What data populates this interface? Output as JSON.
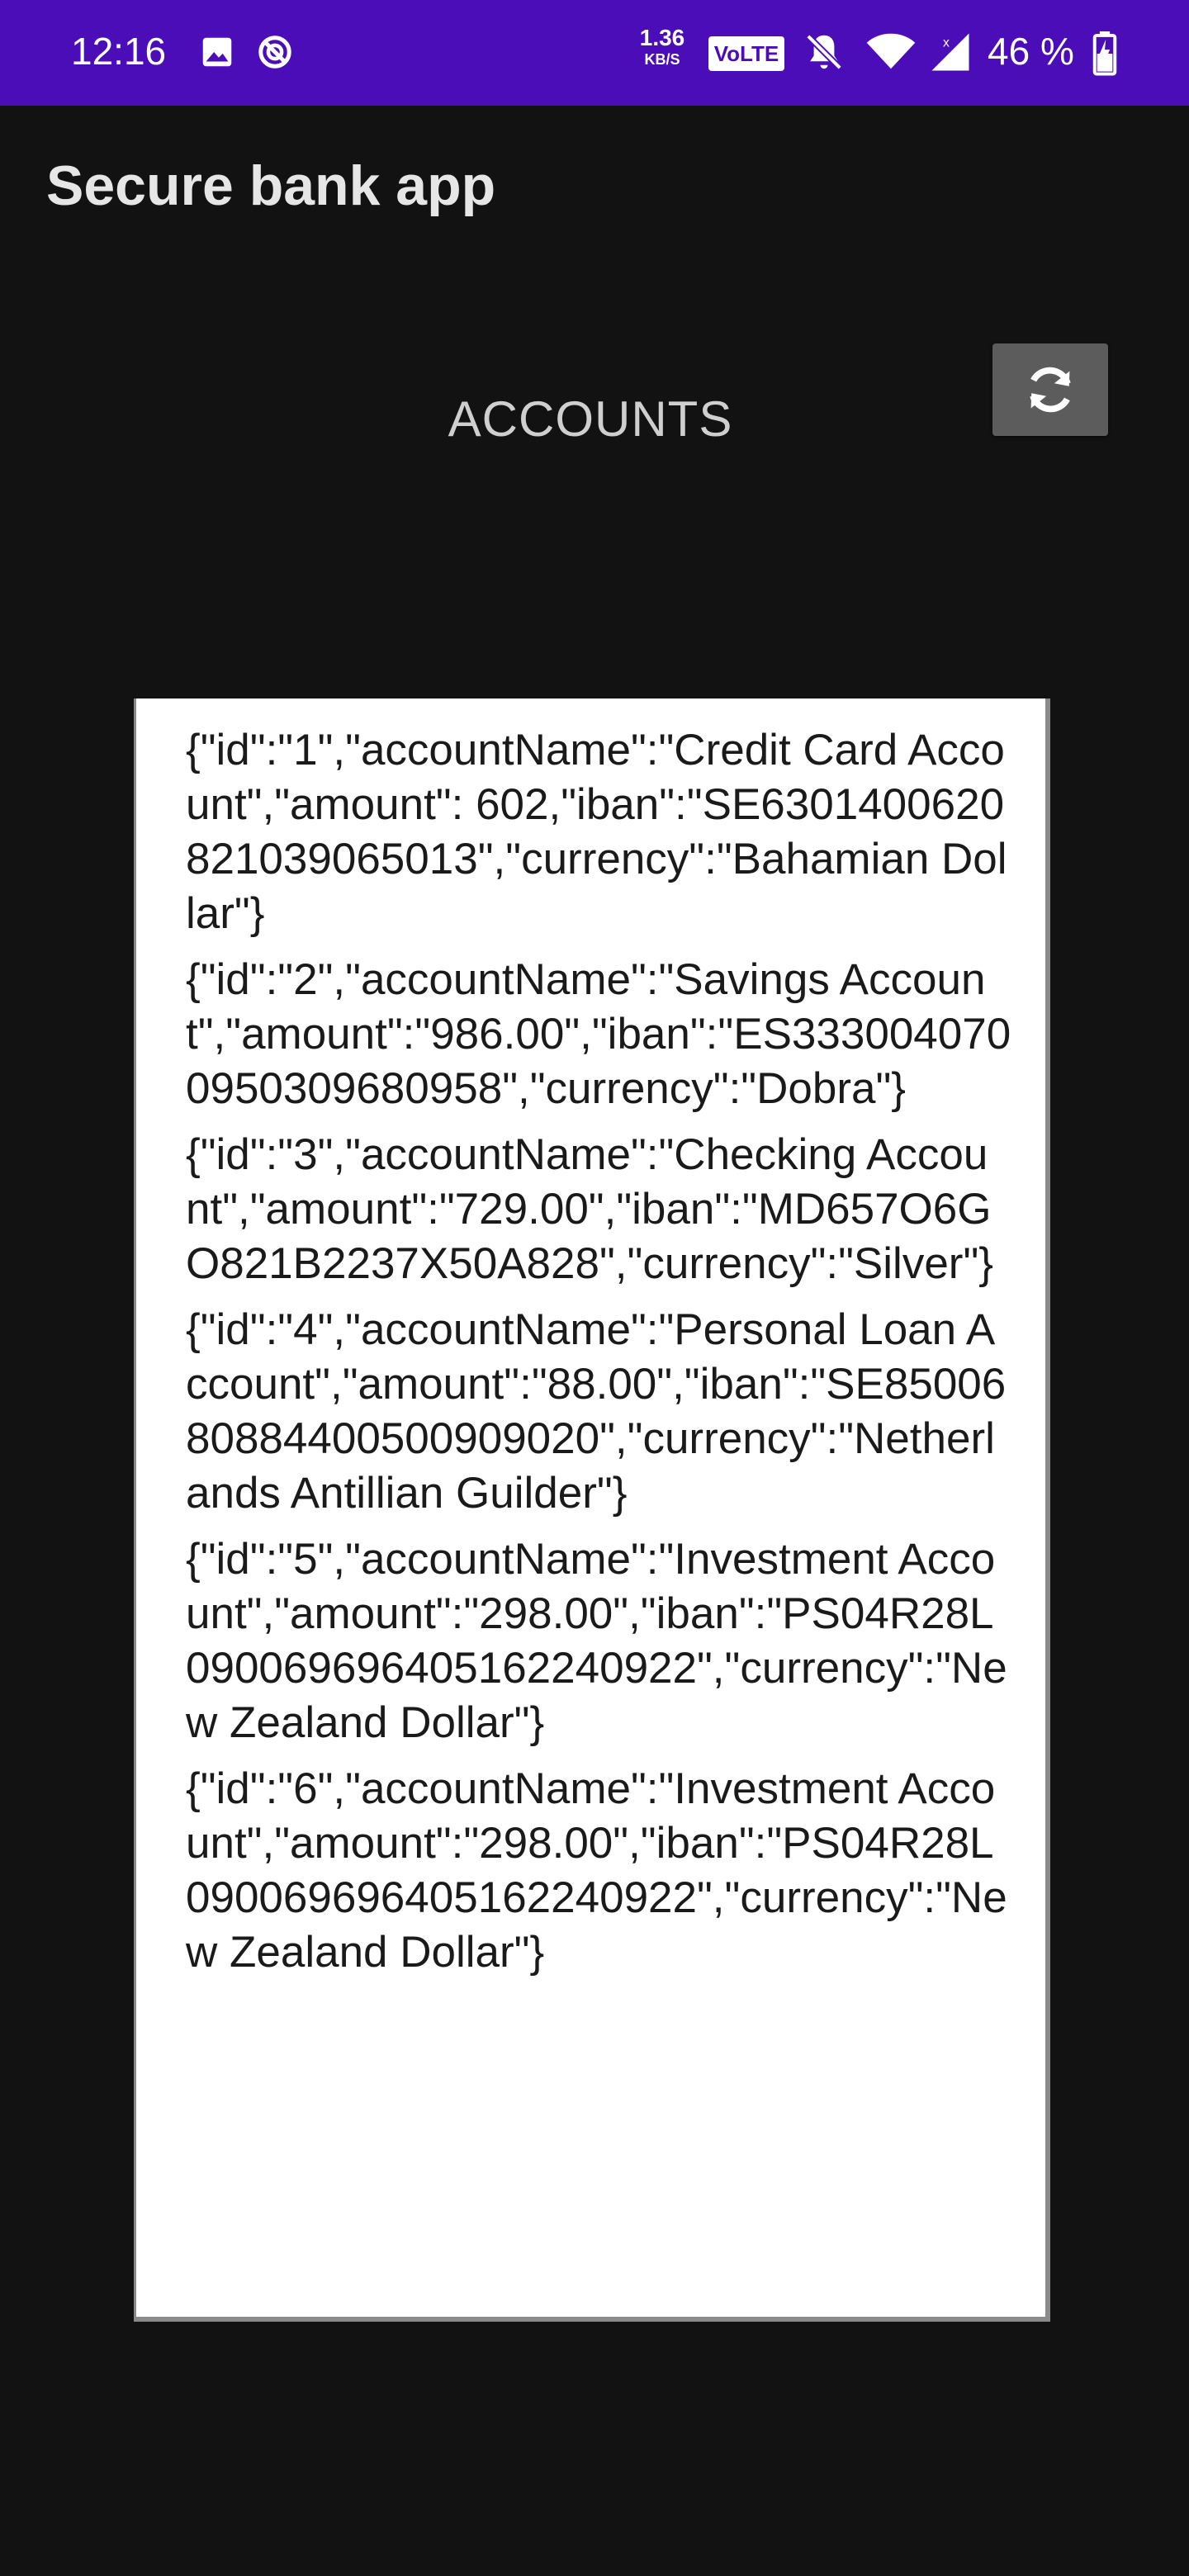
{
  "status_bar": {
    "time": "12:16",
    "net_speed_value": "1.36",
    "net_speed_unit": "KB/S",
    "volte_label": "VoLTE",
    "battery_percent": "46 %",
    "left_icons": [
      "image-icon",
      "do-not-disturb-icon"
    ],
    "right_icons": [
      "bell-off-icon",
      "wifi-icon",
      "cellular-signal-icon",
      "battery-charging-icon"
    ],
    "background_color": "#4a0db8"
  },
  "app": {
    "title": "Secure bank app"
  },
  "main": {
    "heading": "ACCOUNTS",
    "refresh_icon": "refresh-icon",
    "accounts": [
      "{\"id\":\"1\",\"accountName\":\"Credit Card Account\",\"amount\": 602,\"iban\":\"SE6301400620821039065013\",\"currency\":\"Bahamian Dollar\"}",
      "{\"id\":\"2\",\"accountName\":\"Savings Account\",\"amount\":\"986.00\",\"iban\":\"ES3330040700950309680958\",\"currency\":\"Dobra\"}",
      "{\"id\":\"3\",\"accountName\":\"Checking Account\",\"amount\":\"729.00\",\"iban\":\"MD657O6GO821B2237X50A828\",\"currency\":\"Silver\"}",
      "{\"id\":\"4\",\"accountName\":\"Personal Loan Account\",\"amount\":\"88.00\",\"iban\":\"SE8500680884400500909020\",\"currency\":\"Netherlands Antillian Guilder\"}",
      "{\"id\":\"5\",\"accountName\":\"Investment Account\",\"amount\":\"298.00\",\"iban\":\"PS04R28L090069696405162240922\",\"currency\":\"New Zealand Dollar\"}",
      "{\"id\":\"6\",\"accountName\":\"Investment Account\",\"amount\":\"298.00\",\"iban\":\"PS04R28L090069696405162240922\",\"currency\":\"New Zealand Dollar\"}"
    ]
  }
}
